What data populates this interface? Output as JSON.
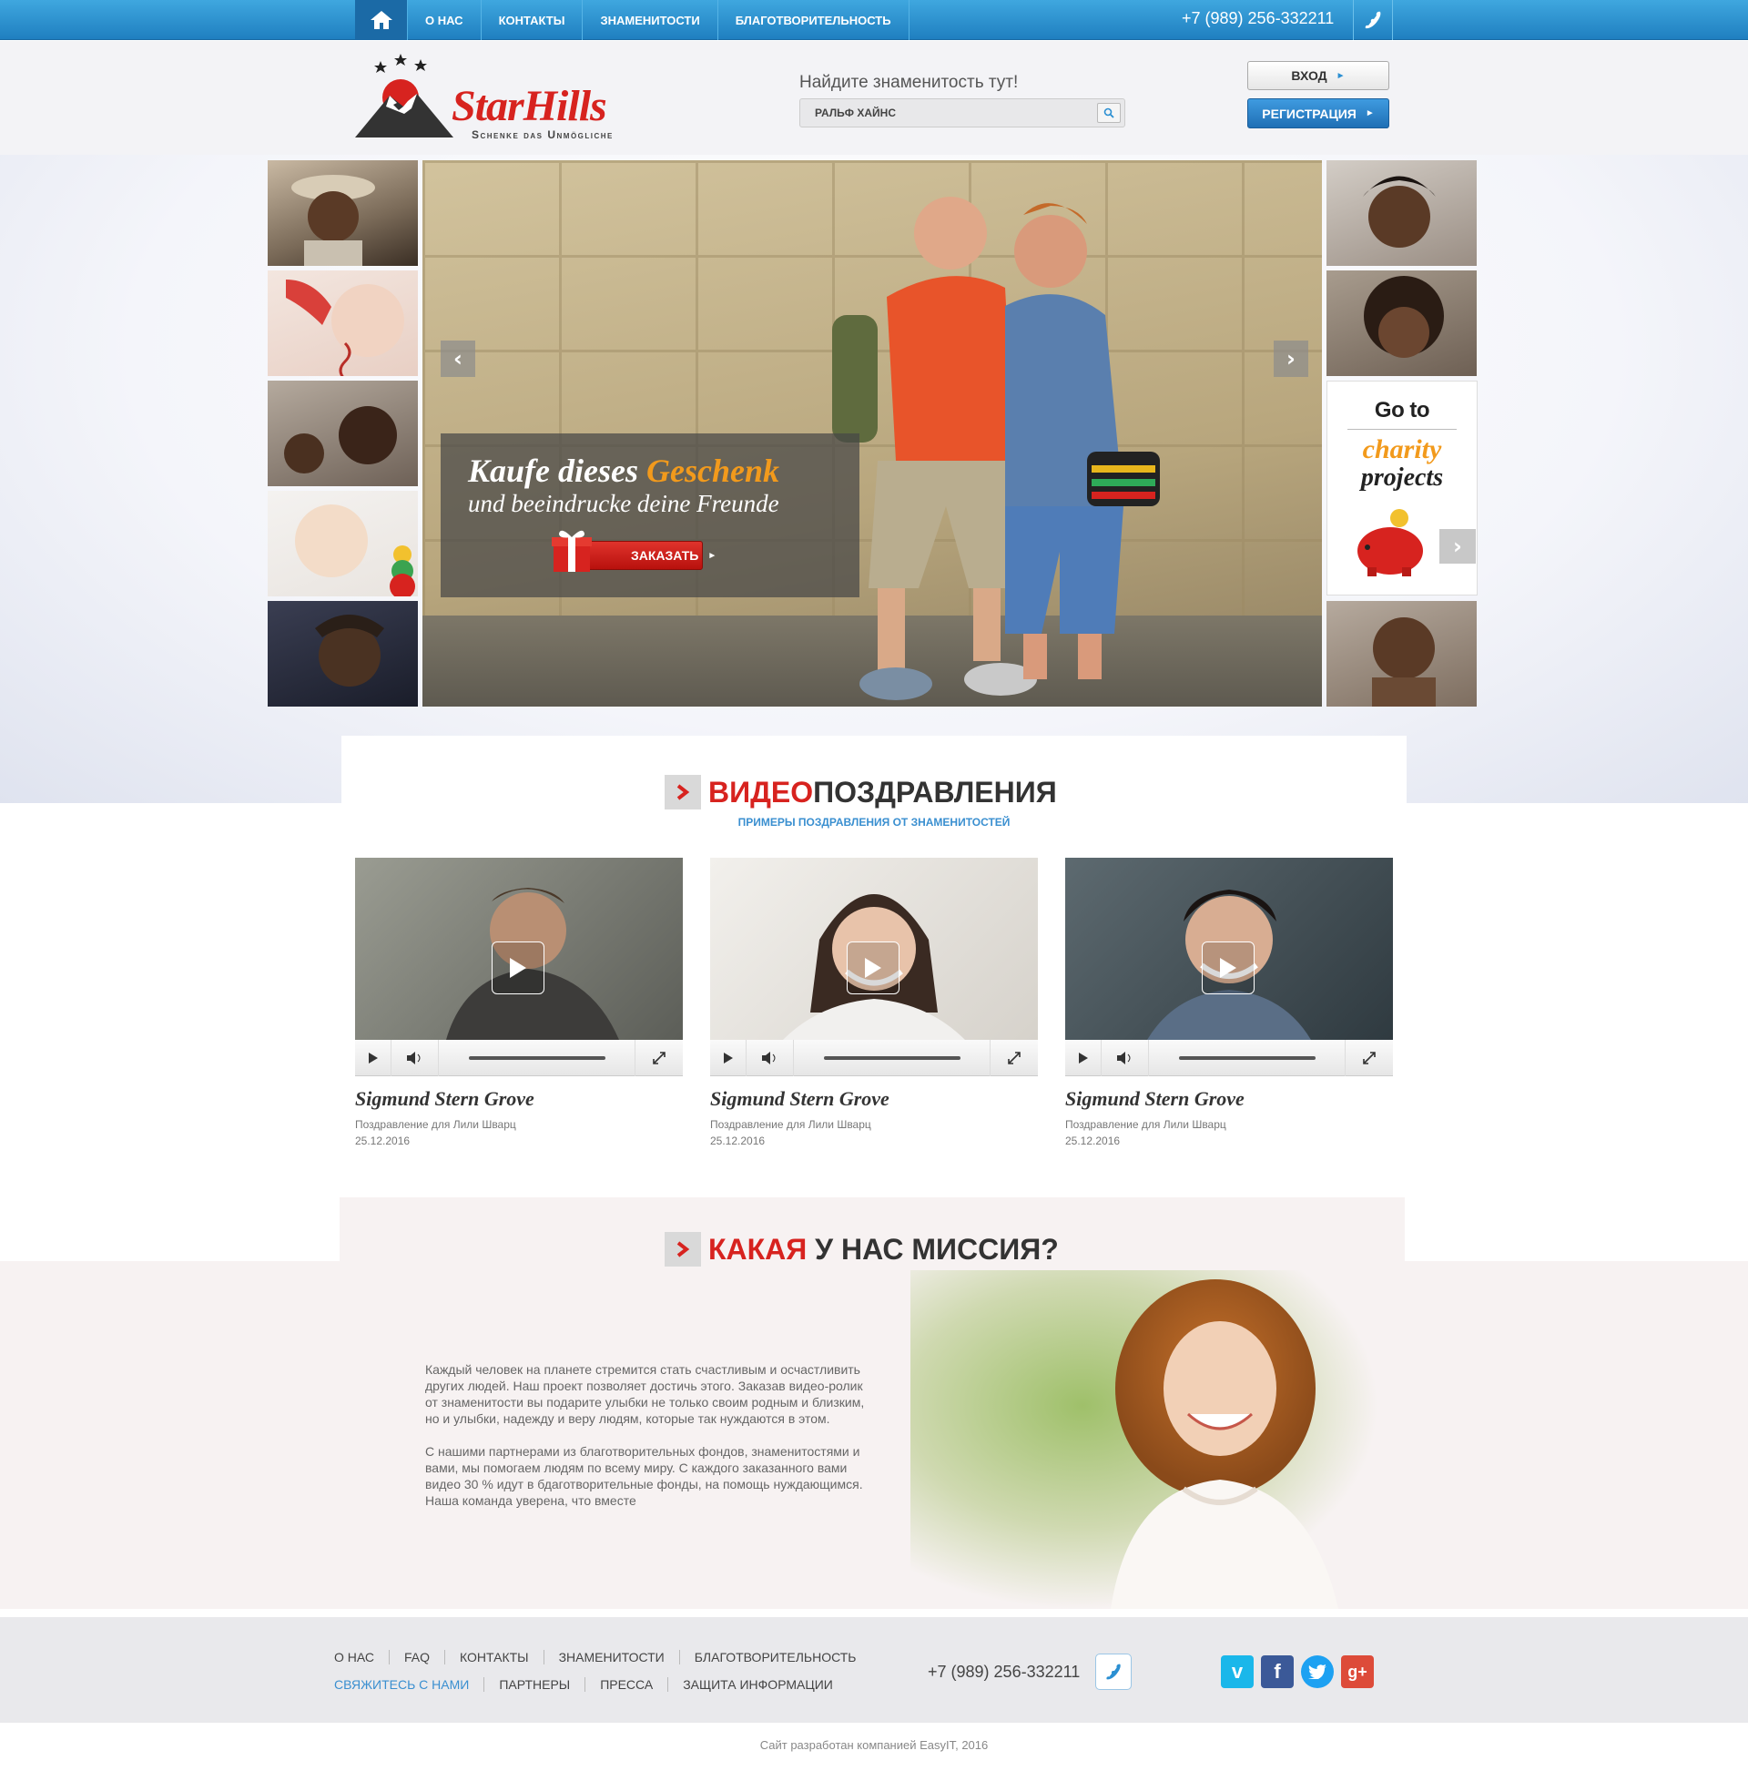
{
  "topbar": {
    "nav": [
      "О НАС",
      "КОНТАКТЫ",
      "ЗНАМЕНИТОСТИ",
      "БЛАГОТВОРИТЕЛЬНОСТЬ"
    ],
    "phone": "+7 (989) 256-332211"
  },
  "header": {
    "logo_name": "StarHills",
    "logo_slogan": "Schenke das Unmögliche",
    "search_label": "Найдите знаменитость тут!",
    "search_value": "РАЛЬФ ХАЙНС",
    "login": "ВХОД",
    "register": "РЕГИСТРАЦИЯ"
  },
  "slider": {
    "caption_prefix": "Kaufe dieses",
    "caption_highlight": "Geschenk",
    "caption_line2": "und beeindrucke deine Freunde",
    "order_button": "ЗАКАЗАТЬ",
    "charity_goto": "Go to",
    "charity_word1": "charity",
    "charity_word2": "projects"
  },
  "videos_section": {
    "title_red": "ВИДЕО",
    "title_rest": "ПОЗДРАВЛЕНИЯ",
    "subtitle": "ПРИМЕРЫ ПОЗДРАВЛЕНИЯ ОТ ЗНАМЕНИТОСТЕЙ",
    "items": [
      {
        "name": "Sigmund Stern Grove",
        "sub": "Поздравление для Лили Шварц",
        "date": "25.12.2016"
      },
      {
        "name": "Sigmund Stern Grove",
        "sub": "Поздравление для Лили Шварц",
        "date": "25.12.2016"
      },
      {
        "name": "Sigmund Stern Grove",
        "sub": "Поздравление для Лили Шварц",
        "date": "25.12.2016"
      }
    ]
  },
  "mission": {
    "title_red": "КАКАЯ",
    "title_rest": " У НАС МИССИЯ?",
    "p1": "Каждый человек на планете стремится стать счастливым и осчастливить других людей. Наш проект позволяет достичь этого. Заказав видео-ролик от знаменитости вы подарите улыбки не только своим родным и близким, но и улыбки, надежду и веру людям, которые так нуждаются в этом.",
    "p2": "С нашими партнерами из благотворительных фондов, знаменитостями и вами, мы помогаем людям по всему миру. С каждого заказанного вами видео 30 % идут в бдаготворительные фонды, на помощь нуждающимся. Наша команда уверена, что вместе"
  },
  "footer": {
    "nav1": [
      "О НАС",
      "FAQ",
      "КОНТАКТЫ",
      "ЗНАМЕНИТОСТИ",
      "БЛАГОТВОРИТЕЛЬНОСТЬ"
    ],
    "nav2": [
      "СВЯЖИТЕСЬ С НАМИ",
      "ПАРТНЕРЫ",
      "ПРЕССА",
      "ЗАЩИТА ИНФОРМАЦИИ"
    ],
    "phone": "+7 (989) 256-332211",
    "social": [
      "vimeo-icon",
      "facebook-icon",
      "twitter-icon",
      "google-plus-icon"
    ],
    "copyright": "Сайт разработан компанией EasyIT, 2016"
  },
  "colors": {
    "brand_red": "#d7231f",
    "brand_blue": "#2b8fd2",
    "accent_orange": "#f29a1c"
  }
}
